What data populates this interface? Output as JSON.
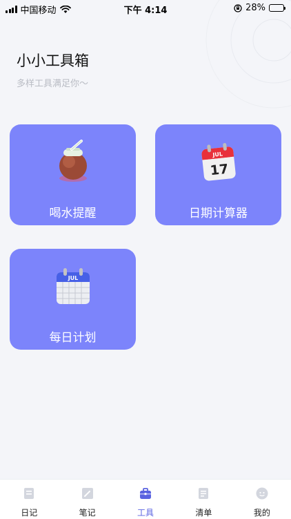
{
  "status_bar": {
    "carrier": "中国移动",
    "time": "下午 4:14",
    "battery_percent": "28%",
    "battery_level": 0.28
  },
  "header": {
    "title": "小小工具箱",
    "subtitle": "多样工具满足你～"
  },
  "tools": [
    {
      "label": "喝水提醒",
      "icon": "water-jar-icon"
    },
    {
      "label": "日期计算器",
      "icon": "calendar-date-icon",
      "icon_month": "JUL",
      "icon_day": "17"
    },
    {
      "label": "每日计划",
      "icon": "calendar-plan-icon",
      "icon_month": "JUL"
    }
  ],
  "tab_bar": {
    "items": [
      {
        "label": "日记",
        "icon": "diary-icon"
      },
      {
        "label": "笔记",
        "icon": "note-icon"
      },
      {
        "label": "工具",
        "icon": "toolbox-icon",
        "active": true
      },
      {
        "label": "清单",
        "icon": "checklist-icon"
      },
      {
        "label": "我的",
        "icon": "profile-icon"
      }
    ]
  },
  "colors": {
    "card": "#7c84fb",
    "accent": "#5a63e0",
    "background": "#f4f5f9",
    "subtitle": "#b9bcc4"
  }
}
